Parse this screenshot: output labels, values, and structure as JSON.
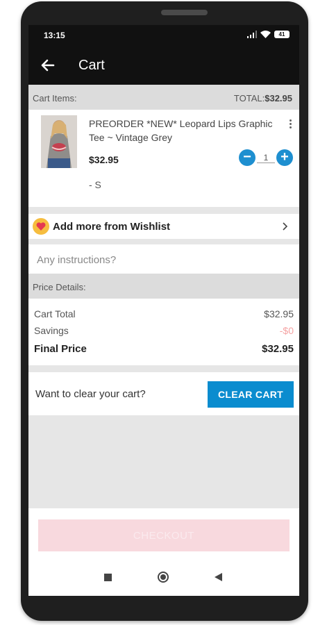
{
  "status_bar": {
    "time": "13:15",
    "battery": "41"
  },
  "app_bar": {
    "title": "Cart"
  },
  "cart": {
    "items_label": "Cart Items:",
    "total_label": "TOTAL:",
    "total_value": "$32.95",
    "items": [
      {
        "title": "PREORDER *NEW* Leopard Lips Graphic Tee ~ Vintage Grey",
        "price": "$32.95",
        "quantity": "1",
        "variant": "- S"
      }
    ]
  },
  "wishlist": {
    "label": "Add more from Wishlist"
  },
  "instructions": {
    "placeholder": "Any instructions?",
    "value": ""
  },
  "price_details": {
    "header": "Price Details:",
    "rows": [
      {
        "label": "Cart Total",
        "value": "$32.95"
      },
      {
        "label": "Savings",
        "value": "-$0"
      },
      {
        "label": "Final Price",
        "value": "$32.95"
      }
    ]
  },
  "clear": {
    "question": "Want to clear your cart?",
    "button": "CLEAR CART"
  },
  "checkout": {
    "button": "CHECKOUT"
  },
  "colors": {
    "accent": "#0a8ccf",
    "checkout_disabled": "#f8d9de",
    "heart": "#e53950",
    "wishlist_badge": "#f6bd3f"
  }
}
